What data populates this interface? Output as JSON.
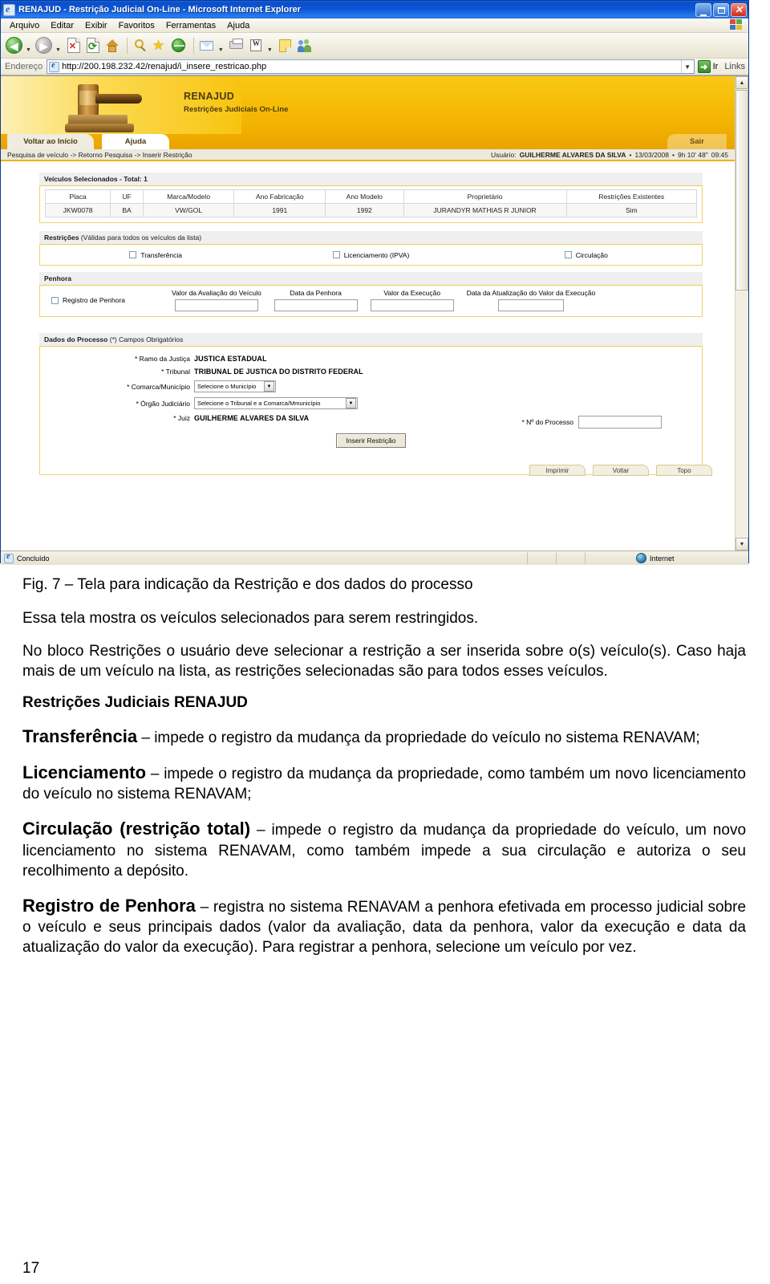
{
  "browser": {
    "title": "RENAJUD - Restrição Judicial On-Line - Microsoft Internet Explorer",
    "menu": [
      "Arquivo",
      "Editar",
      "Exibir",
      "Favoritos",
      "Ferramentas",
      "Ajuda"
    ],
    "address_label": "Endereço",
    "address_value": "http://200.198.232.42/renajud/i_insere_restricao.php",
    "go_label": "Ir",
    "links_label": "Links",
    "status_text": "Concluído",
    "zone_text": "Internet",
    "window_controls": {
      "minimize": "_",
      "restore": "❐",
      "close": "✕"
    },
    "toolbar_icons": [
      "back-icon",
      "forward-icon",
      "stop-icon",
      "refresh-icon",
      "home-icon",
      "search-icon",
      "favorites-icon",
      "history-icon",
      "mail-icon",
      "print-icon",
      "edit-word-icon",
      "notes-icon",
      "messenger-icon"
    ]
  },
  "renajud": {
    "brand_title": "RENAJUD",
    "brand_subtitle": "Restrições Judiciais On-Line",
    "tabs": {
      "home": "Voltar ao Início",
      "help": "Ajuda",
      "exit": "Sair"
    },
    "breadcrumb": "Pesquisa de veículo -> Retorno Pesquisa -> Inserir Restrição",
    "user_label": "Usuário:",
    "user_name": "GUILHERME ALVARES DA SILVA",
    "date": "13/03/2008",
    "session_time": "9h 10' 48\"",
    "clock": "09:45",
    "vehicles": {
      "section_title": "Veículos Selecionados - Total: 1",
      "columns": [
        "Placa",
        "UF",
        "Marca/Modelo",
        "Ano Fabricação",
        "Ano Modelo",
        "Proprietário",
        "Restrições Existentes"
      ],
      "rows": [
        [
          "JKW0078",
          "BA",
          "VW/GOL",
          "1991",
          "1992",
          "JURANDYR MATHIAS R JUNIOR",
          "Sim"
        ]
      ]
    },
    "restricoes": {
      "section_title": "Restrições",
      "section_note": "(Válidas para todos os veículos da lista)",
      "options": [
        "Transferência",
        "Licenciamento (IPVA)",
        "Circulação"
      ]
    },
    "penhora": {
      "section_title": "Penhora",
      "checkbox_label": "Registro de Penhora",
      "fields": [
        {
          "label": "Valor da Avaliação do Veículo",
          "value": ""
        },
        {
          "label": "Data da Penhora",
          "value": ""
        },
        {
          "label": "Valor da Execução",
          "value": ""
        },
        {
          "label": "Data da Atualização do Valor da Execução",
          "value": ""
        }
      ]
    },
    "processo": {
      "section_title": "Dados do Processo",
      "section_note": "(*) Campos Obrigatórios",
      "ramo_label": "* Ramo da Justiça",
      "ramo_value": "JUSTICA ESTADUAL",
      "tribunal_label": "* Tribunal",
      "tribunal_value": "TRIBUNAL DE JUSTICA DO DISTRITO FEDERAL",
      "comarca_label": "* Comarca/Município",
      "comarca_value": "Selecione o Município",
      "orgao_label": "* Órgão Judiciário",
      "orgao_value": "Selecione o Tribunal e a Comarca/Mmunicípio",
      "juiz_label": "* Juiz",
      "juiz_value": "GUILHERME ALVARES DA SILVA",
      "processo_label": "* Nº do Processo",
      "processo_value": "",
      "submit_label": "Inserir Restrição"
    },
    "bottom_tabs": [
      "Imprimir",
      "Voltar",
      "Topo"
    ]
  },
  "document": {
    "figure_caption": "Fig. 7 – Tela para indicação da Restrição e dos dados do processo",
    "p1": "Essa tela mostra os veículos selecionados para serem restringidos.",
    "p2": "No bloco Restrições o usuário deve selecionar a restrição a ser inserida sobre o(s) veículo(s). Caso haja mais de um veículo na lista, as restrições selecionadas são para todos esses veículos.",
    "heading": "Restrições Judiciais RENAJUD",
    "items": [
      {
        "term": "Transferência",
        "dash": " – ",
        "text": "impede o registro da mudança da propriedade do veículo no sistema RENAVAM;"
      },
      {
        "term": "Licenciamento",
        "dash": " – ",
        "text": "impede o registro da mudança da propriedade, como também um novo licenciamento do veículo no sistema RENAVAM;"
      },
      {
        "term": "Circulação (restrição total)",
        "dash": " – ",
        "text": "impede o registro da mudança da propriedade do veículo, um novo licenciamento no sistema RENAVAM, como também impede a sua circulação e autoriza o seu recolhimento a depósito."
      },
      {
        "term": "Registro de Penhora",
        "dash": " – ",
        "text": "registra no sistema RENAVAM a penhora efetivada em processo judicial sobre o veículo e seus principais dados (valor da avaliação, data da penhora, valor da execução e data da atualização do valor da execução). Para registrar a penhora, selecione um veículo por vez."
      }
    ],
    "page_number": "17"
  }
}
